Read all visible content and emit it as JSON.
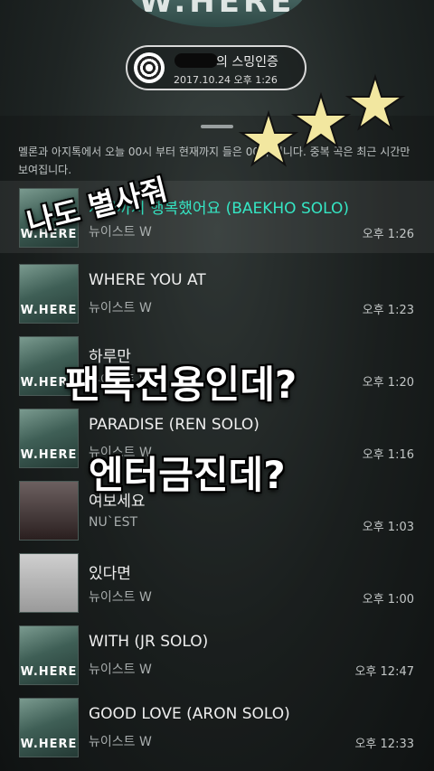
{
  "header": {
    "album_art_text": "W.HERE",
    "badge_title": "의 스밍인증",
    "badge_date": "2017.10.24 오후 1:26"
  },
  "notice": "멜론과 아지톡에서 오늘 00시 부터 현재까지 들은 00곡 입니다. 중복 곡은 최근 시간만 보여집니다.",
  "songs": [
    {
      "title": "지금까지 행복했어요 (BAEKHO SOLO)",
      "artist": "뉴이스트 W",
      "time": "오후 1:26",
      "cover": "W.HERE"
    },
    {
      "title": "WHERE YOU AT",
      "artist": "뉴이스트 W",
      "time": "오후 1:23",
      "cover": "W.HERE"
    },
    {
      "title": "하루만",
      "artist": "뉴이스트 W",
      "time": "오후 1:20",
      "cover": "W.HERE"
    },
    {
      "title": "PARADISE (REN SOLO)",
      "artist": "뉴이스트 W",
      "time": "오후 1:16",
      "cover": "W.HERE"
    },
    {
      "title": "여보세요",
      "artist": "NU`EST",
      "time": "오후 1:03",
      "cover": ""
    },
    {
      "title": "있다면",
      "artist": "뉴이스트 W",
      "time": "오후 1:00",
      "cover": ""
    },
    {
      "title": "WITH (JR SOLO)",
      "artist": "뉴이스트 W",
      "time": "오후 12:47",
      "cover": "W.HERE"
    },
    {
      "title": "GOOD LOVE (ARON SOLO)",
      "artist": "뉴이스트 W",
      "time": "오후 12:33",
      "cover": "W.HERE"
    }
  ],
  "overlays": {
    "line1": "나도 별사줘",
    "line2": "팬톡전용인데?",
    "line3": "엔터금진데?"
  },
  "colors": {
    "active_title": "#35e6c4",
    "star_fill": "#f2e7a0"
  }
}
